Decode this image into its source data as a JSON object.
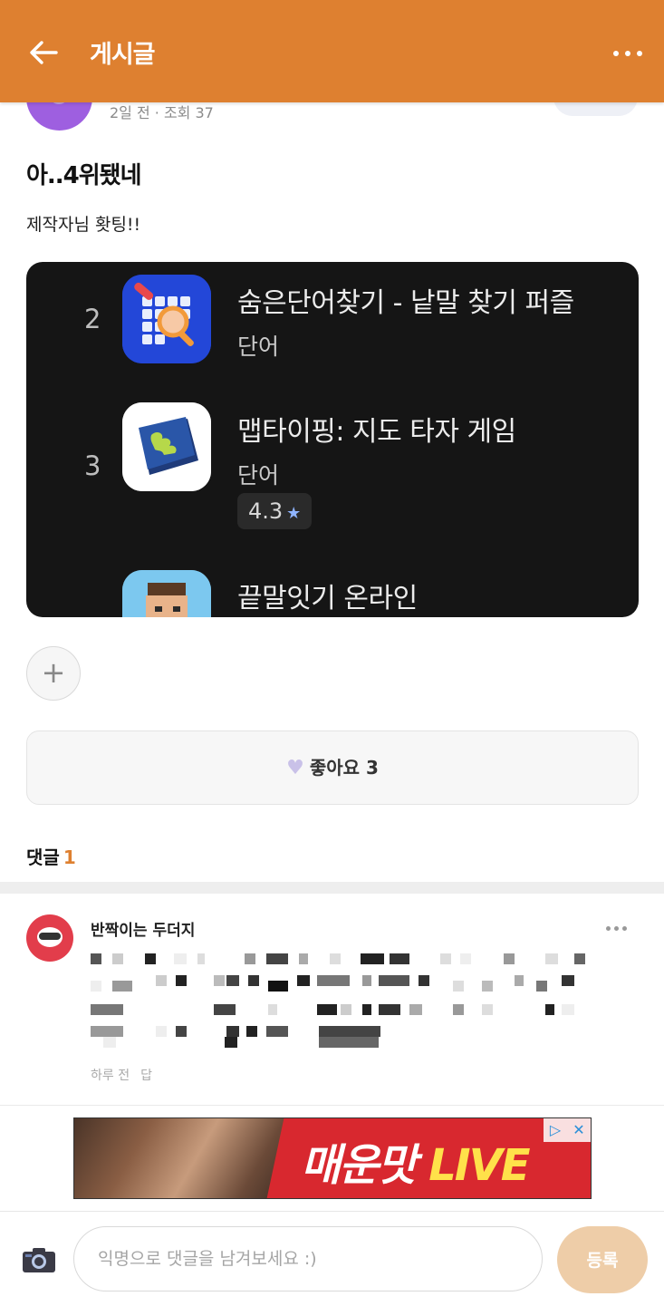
{
  "header": {
    "title": "게시글",
    "back_icon": "arrow-left-icon",
    "more_icon": "more-horizontal-icon",
    "accent_color": "#DE8030"
  },
  "post": {
    "meta": "2일 전 · 조회 37",
    "title": "아..4위됐네",
    "body": "제작자님 홧팅!!",
    "screenshot": {
      "items": [
        {
          "rank": "2",
          "name": "숨은단어찾기 - 낱말 찾기 퍼즐",
          "category": "단어",
          "icon": "word-search-puzzle-icon"
        },
        {
          "rank": "3",
          "name": "맵타이핑: 지도 타자 게임",
          "category": "단어",
          "rating": "4.3",
          "icon": "map-keyboard-icon"
        },
        {
          "rank": "",
          "name": "끝말잇기 온라인",
          "category": "",
          "icon": "word-chain-character-icon"
        }
      ]
    },
    "like_label": "좋아요 3"
  },
  "comments": {
    "label": "댓글",
    "count": "1",
    "items": [
      {
        "author": "반짝이는 두더지",
        "meta_time": "하루 전",
        "meta_reply": "답"
      }
    ]
  },
  "ad": {
    "headline": "매운맛",
    "headline_accent": "LIVE"
  },
  "input_bar": {
    "placeholder": "익명으로 댓글을 남겨보세요 :)",
    "submit_label": "등록",
    "camera_icon": "camera-icon"
  }
}
